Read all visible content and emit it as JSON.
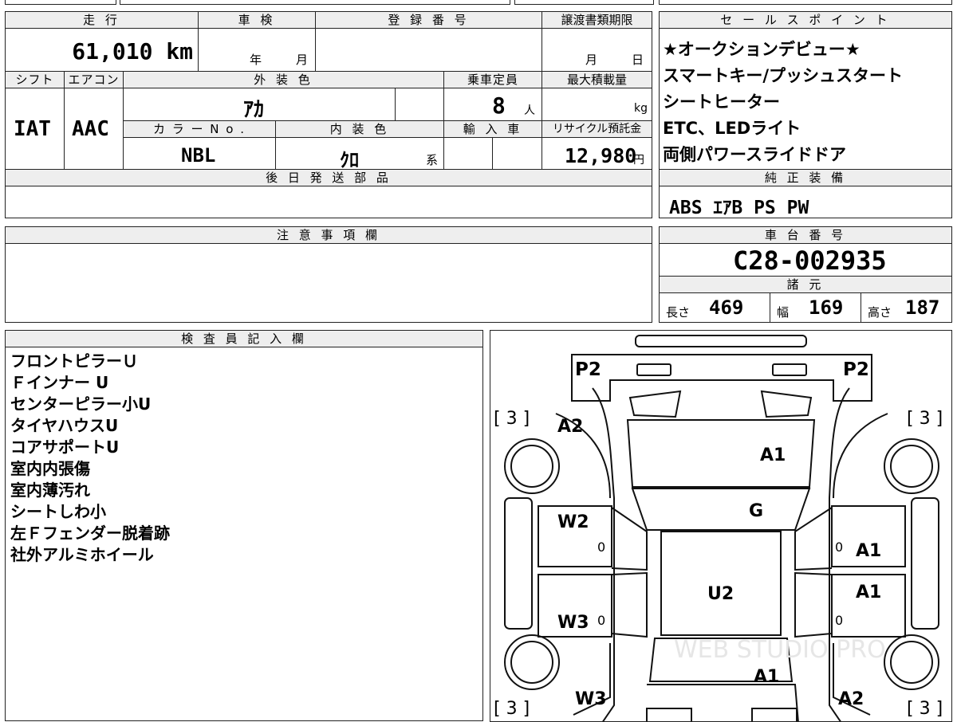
{
  "top": {
    "mileage_label": "走 行",
    "shaken_label": "車 検",
    "reg_label": "登 録 番 号",
    "deadline_label": "譲渡書類期限",
    "mileage": "61,010 km",
    "shaken_year": "年",
    "shaken_month": "月",
    "deadline_month": "月",
    "deadline_day": "日",
    "shift_label": "シフト",
    "ac_label": "エアコン",
    "exterior_label": "外 装 色",
    "capacity_label": "乗車定員",
    "max_load_label": "最大積載量",
    "shift": "IAT",
    "ac": "AAC",
    "exterior": "ｱｶ",
    "capacity": "8",
    "capacity_unit": "人",
    "load_unit": "kg",
    "color_no_label": "カ ラ ー N o .",
    "interior_label": "内 装 色",
    "import_label": "輸 入 車",
    "recycle_label": "リサイクル預託金",
    "color_no": "NBL",
    "interior": "ｸﾛ",
    "interior_suffix": "系",
    "recycle": "12,980",
    "recycle_unit": "円",
    "later_parts_label": "後 日 発 送 部 品"
  },
  "sales": {
    "label": "セ ー ル ス ポ イ ン ト",
    "items": [
      "★オークションデビュー★",
      "スマートキー/プッシュスタート",
      "シートヒーター",
      "ETC、LEDライト",
      "両側パワースライドドア"
    ]
  },
  "genuine": {
    "label": "純 正 装 備",
    "value": "ABS ｴｱB PS PW"
  },
  "notes": {
    "label": "注 意 事 項 欄"
  },
  "chassis": {
    "label": "車 台 番 号",
    "value": "C28-002935",
    "spec_label": "諸 元",
    "length_label": "長さ",
    "length": "469",
    "width_label": "幅",
    "width": "169",
    "height_label": "高さ",
    "height": "187"
  },
  "inspector": {
    "label": "検 査 員 記 入 欄",
    "items": [
      "フロントピラーＵ",
      "Ｆインナー U",
      "センターピラー小U",
      "タイヤハウスU",
      "コアサポートU",
      "室内内張傷",
      "室内薄汚れ",
      "シートしわ小",
      "左Ｆフェンダー脱着跡",
      "社外アルミホイール"
    ]
  },
  "diagram": {
    "marks": {
      "p2_left": "P2",
      "p2_right": "P2",
      "tire_fl": "[ 3 ]",
      "tire_fr": "[ 3 ]",
      "tire_rl": "[ 3 ]",
      "tire_rr": "[ 3 ]",
      "a2_front_left": "A2",
      "a1_hood": "A1",
      "g_windshield": "G",
      "w2_left_front_door": "W2",
      "a1_right_front_door": "A1",
      "u2_roof": "U2",
      "a1_right_rear_door": "A1",
      "w3_left_rear_door": "W3",
      "a1_rear": "A1",
      "w3_left_rear": "W3",
      "a2_rear_right": "A2",
      "zero_1": "0",
      "zero_2": "0",
      "zero_3": "0",
      "zero_4": "0"
    },
    "watermark": "WEB STUDIO PRO"
  }
}
